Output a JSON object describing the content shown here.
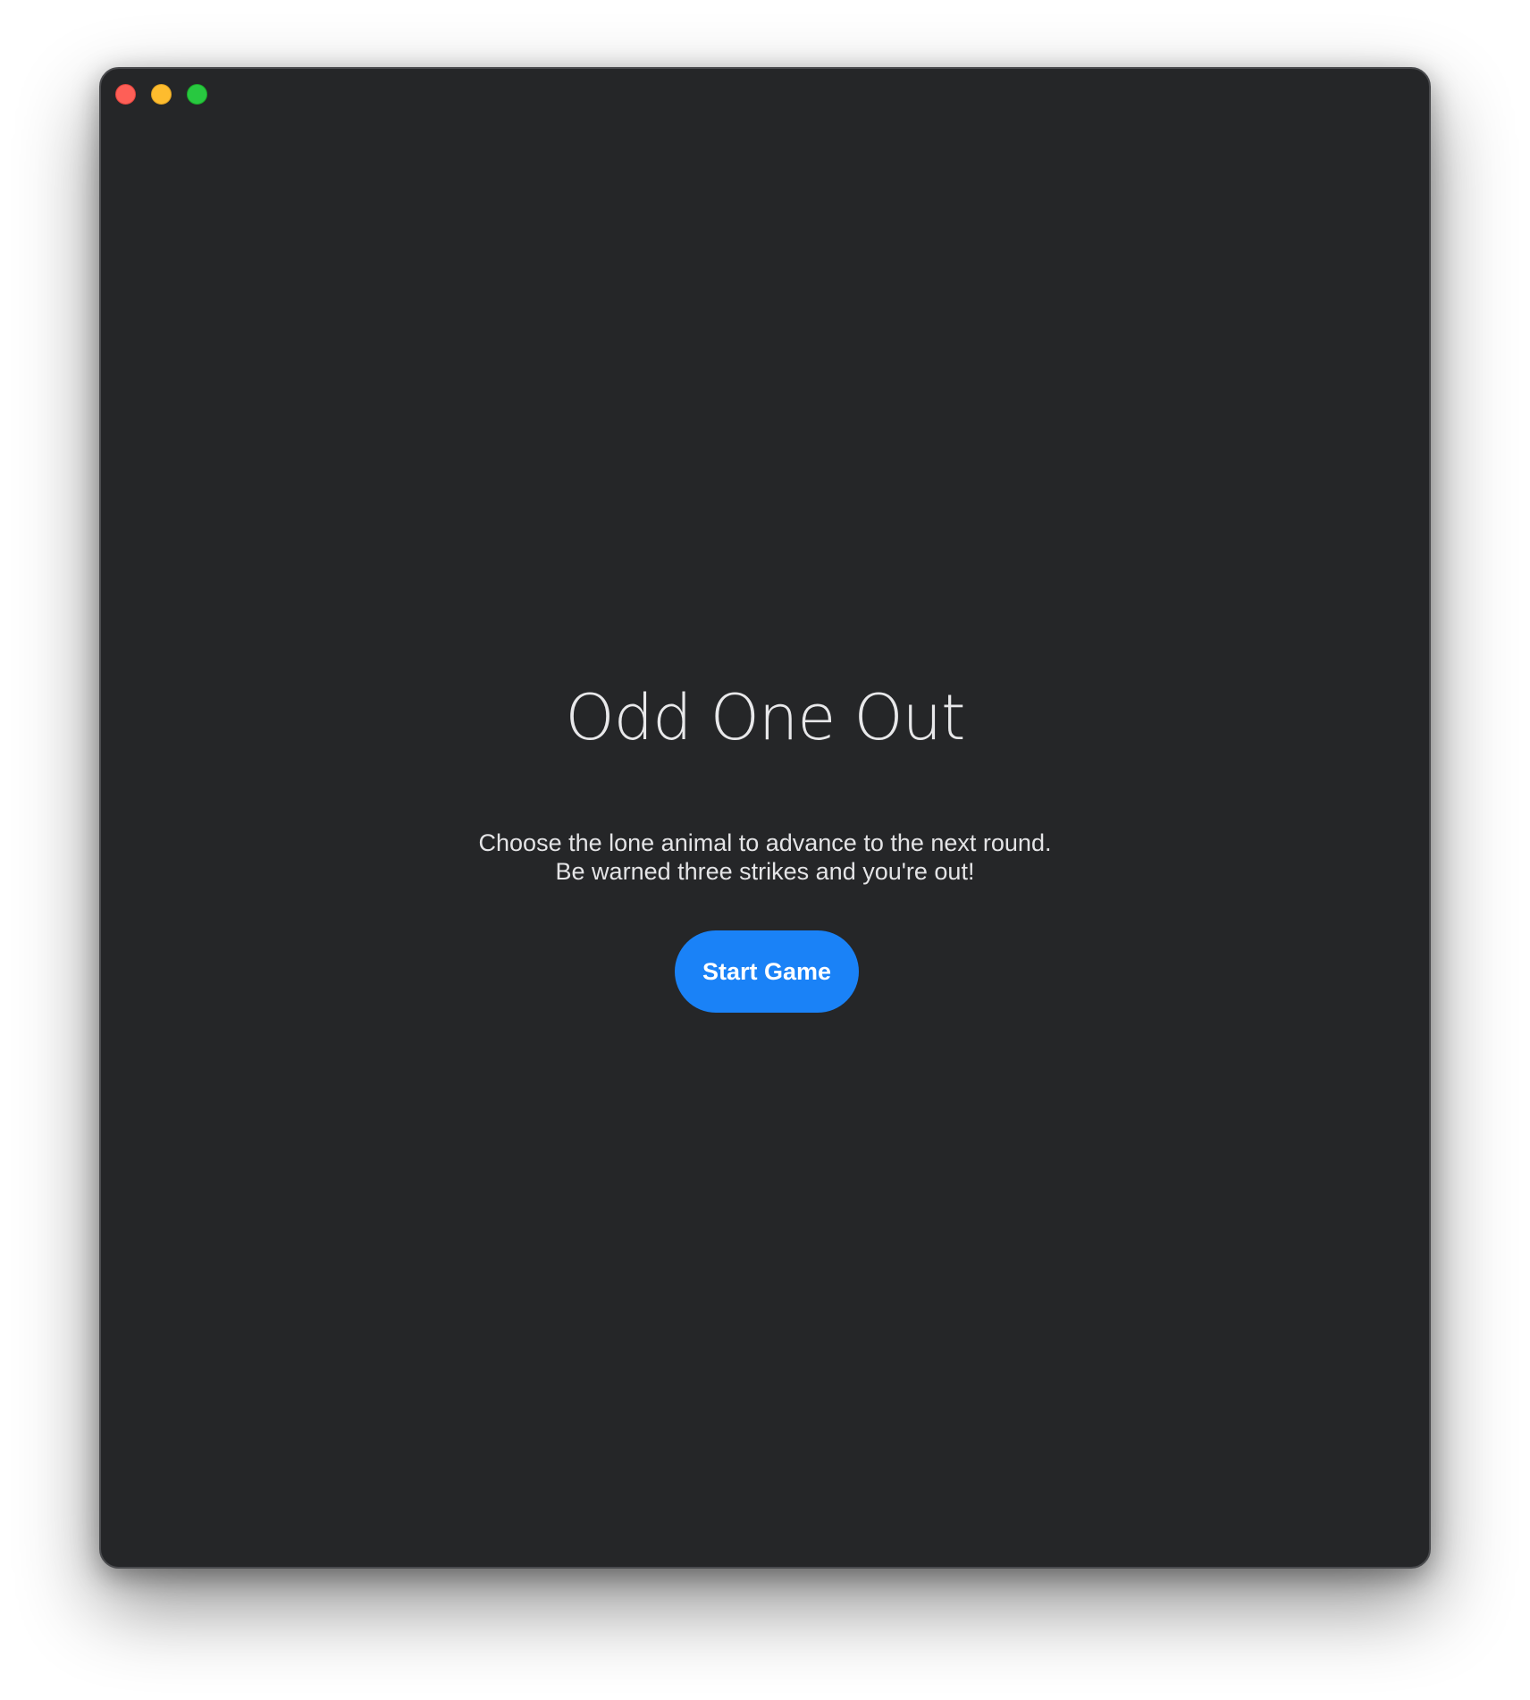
{
  "window": {
    "controls": {
      "close_icon": "close-icon",
      "minimize_icon": "minimize-icon",
      "zoom_icon": "zoom-icon"
    }
  },
  "main": {
    "title": "Odd One Out",
    "description_lines": [
      "Choose the lone animal to advance to the next round.",
      "Be warned three strikes and you're out!"
    ],
    "start_button_label": "Start Game"
  },
  "colors": {
    "window_background": "#252628",
    "accent": "#1a82f7",
    "close": "#fe5f57",
    "minimize": "#febc2e",
    "zoom": "#28c840"
  }
}
